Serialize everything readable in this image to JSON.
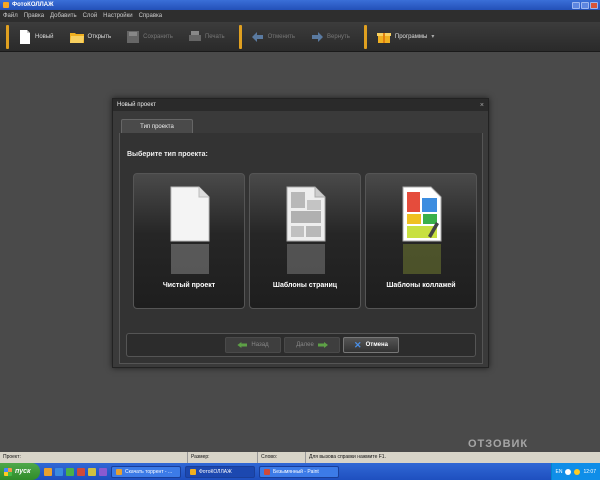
{
  "window": {
    "title": "ФотоКОЛЛАЖ"
  },
  "menu": [
    "Файл",
    "Правка",
    "Добавить",
    "Слой",
    "Настройки",
    "Справка"
  ],
  "toolbar": {
    "new": "Новый",
    "open": "Открыть",
    "save": "Сохранить",
    "print": "Печать",
    "undo": "Отменить",
    "redo": "Вернуть",
    "programs": "Программы"
  },
  "dialog": {
    "title": "Новый проект",
    "close": "×",
    "tab": "Тип проекта",
    "prompt": "Выберите тип проекта:",
    "options": [
      {
        "label": "Чистый проект",
        "icon": "blank-page-icon"
      },
      {
        "label": "Шаблоны страниц",
        "icon": "page-templates-icon"
      },
      {
        "label": "Шаблоны коллажей",
        "icon": "collage-templates-icon"
      }
    ],
    "buttons": {
      "back": "Назад",
      "next": "Далее",
      "cancel": "Отмена"
    }
  },
  "status": {
    "project": "Проект:",
    "size": "Размер:",
    "layer": "Слово:",
    "hint": "Для вызова справки нажмите F1."
  },
  "taskbar": {
    "start": "пуск",
    "tasks": [
      "Скачать торрент - ...",
      "ФотоКОЛЛАЖ",
      "Безымянный - Paint"
    ],
    "lang": "EN",
    "clock": "12:07"
  },
  "watermark": "ОТЗОВИК"
}
